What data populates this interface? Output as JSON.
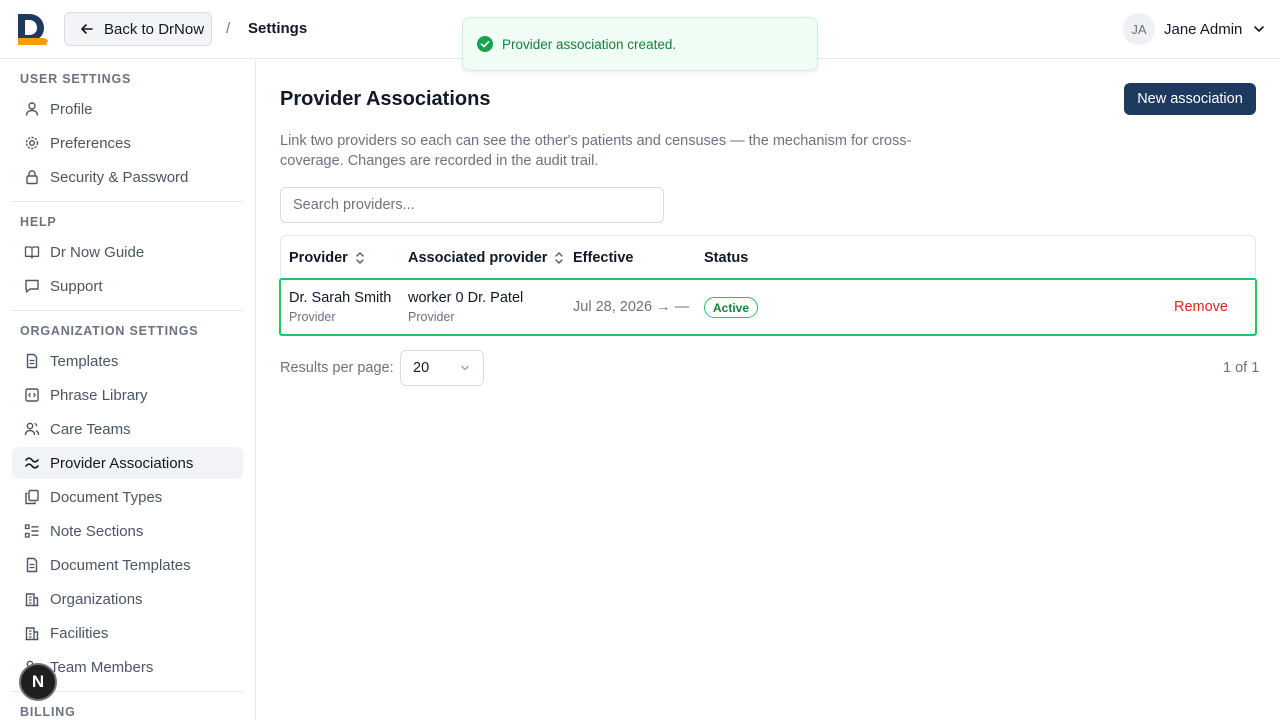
{
  "header": {
    "back_label": "Back to DrNow",
    "breadcrumb_sep": "/",
    "breadcrumb_current": "Settings",
    "user_initials": "JA",
    "user_name": "Jane Admin"
  },
  "toast": {
    "message": "Provider association created."
  },
  "sidebar": {
    "user_settings": {
      "title": "USER SETTINGS",
      "items": [
        {
          "label": "Profile",
          "icon": "user-icon"
        },
        {
          "label": "Preferences",
          "icon": "gear-icon"
        },
        {
          "label": "Security & Password",
          "icon": "lock-icon"
        }
      ]
    },
    "help": {
      "title": "HELP",
      "items": [
        {
          "label": "Dr Now Guide",
          "icon": "book-icon"
        },
        {
          "label": "Support",
          "icon": "chat-icon"
        }
      ]
    },
    "organization_settings": {
      "title": "ORGANIZATION SETTINGS",
      "items": [
        {
          "label": "Templates",
          "icon": "document-icon"
        },
        {
          "label": "Phrase Library",
          "icon": "code-icon"
        },
        {
          "label": "Care Teams",
          "icon": "users-icon"
        },
        {
          "label": "Provider Associations",
          "icon": "link-icon",
          "active": true
        },
        {
          "label": "Document Types",
          "icon": "copy-icon"
        },
        {
          "label": "Note Sections",
          "icon": "list-icon"
        },
        {
          "label": "Document Templates",
          "icon": "document-icon"
        },
        {
          "label": "Organizations",
          "icon": "building-icon"
        },
        {
          "label": "Facilities",
          "icon": "building-icon"
        },
        {
          "label": "Team Members",
          "icon": "users-icon"
        }
      ]
    },
    "billing": {
      "title": "BILLING"
    },
    "fab_label": "N"
  },
  "main": {
    "title": "Provider Associations",
    "new_button": "New association",
    "description": "Link two providers so each can see the other's patients and censuses — the mechanism for cross-coverage. Changes are recorded in the audit trail.",
    "search_placeholder": "Search providers...",
    "table": {
      "columns": [
        "Provider",
        "Associated provider",
        "Effective",
        "Status"
      ],
      "rows": [
        {
          "provider": "Dr. Sarah Smith",
          "provider_role": "Provider",
          "associated": "worker 0 Dr. Patel",
          "associated_role": "Provider",
          "effective": "Jul 28, 2026 → —",
          "status": "Active",
          "action": "Remove"
        }
      ]
    },
    "results_per_page_label": "Results per page:",
    "results_per_page": "20",
    "pagination": "1 of 1"
  },
  "colors": {
    "primary": "#1e3a5f",
    "success": "#22c55e",
    "danger": "#dc2626",
    "logo_blue": "#1e3a5f",
    "logo_orange": "#f59e0b"
  }
}
